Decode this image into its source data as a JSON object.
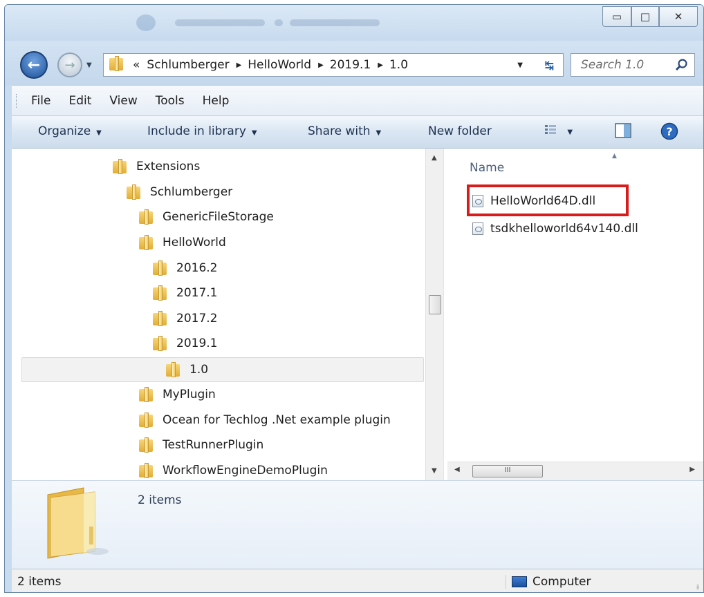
{
  "window": {
    "controls": {
      "minimize": "▭",
      "maximize": "□",
      "close": "✕"
    }
  },
  "address_bar": {
    "overflow": "«",
    "crumbs": [
      "Schlumberger",
      "HelloWorld",
      "2019.1",
      "1.0"
    ]
  },
  "search": {
    "placeholder": "Search 1.0"
  },
  "menu": [
    "File",
    "Edit",
    "View",
    "Tools",
    "Help"
  ],
  "toolbar": {
    "organize": "Organize",
    "include_in_library": "Include in library",
    "share_with": "Share with",
    "new_folder": "New folder"
  },
  "nav_tree": [
    {
      "label": "Extensions"
    },
    {
      "label": "Schlumberger"
    },
    {
      "label": "GenericFileStorage"
    },
    {
      "label": "HelloWorld"
    },
    {
      "label": "2016.2"
    },
    {
      "label": "2017.1"
    },
    {
      "label": "2017.2"
    },
    {
      "label": "2019.1"
    },
    {
      "label": "1.0",
      "selected": true
    },
    {
      "label": "MyPlugin"
    },
    {
      "label": "Ocean for Techlog .Net example plugin"
    },
    {
      "label": "TestRunnerPlugin"
    },
    {
      "label": "WorkflowEngineDemoPlugin"
    }
  ],
  "file_list": {
    "column_header": "Name",
    "files": [
      {
        "name": "HelloWorld64D.dll",
        "highlighted": true
      },
      {
        "name": "tsdkhelloworld64v140.dll",
        "highlighted": false
      }
    ]
  },
  "hscroll_thumb": "III",
  "details_pane": {
    "count": "2 items"
  },
  "status_bar": {
    "left": "2 items",
    "right": "Computer"
  },
  "colors": {
    "highlight_box": "#d91b1b",
    "title_bar": "#c9dbee",
    "back_button": "#1d4f9a"
  }
}
